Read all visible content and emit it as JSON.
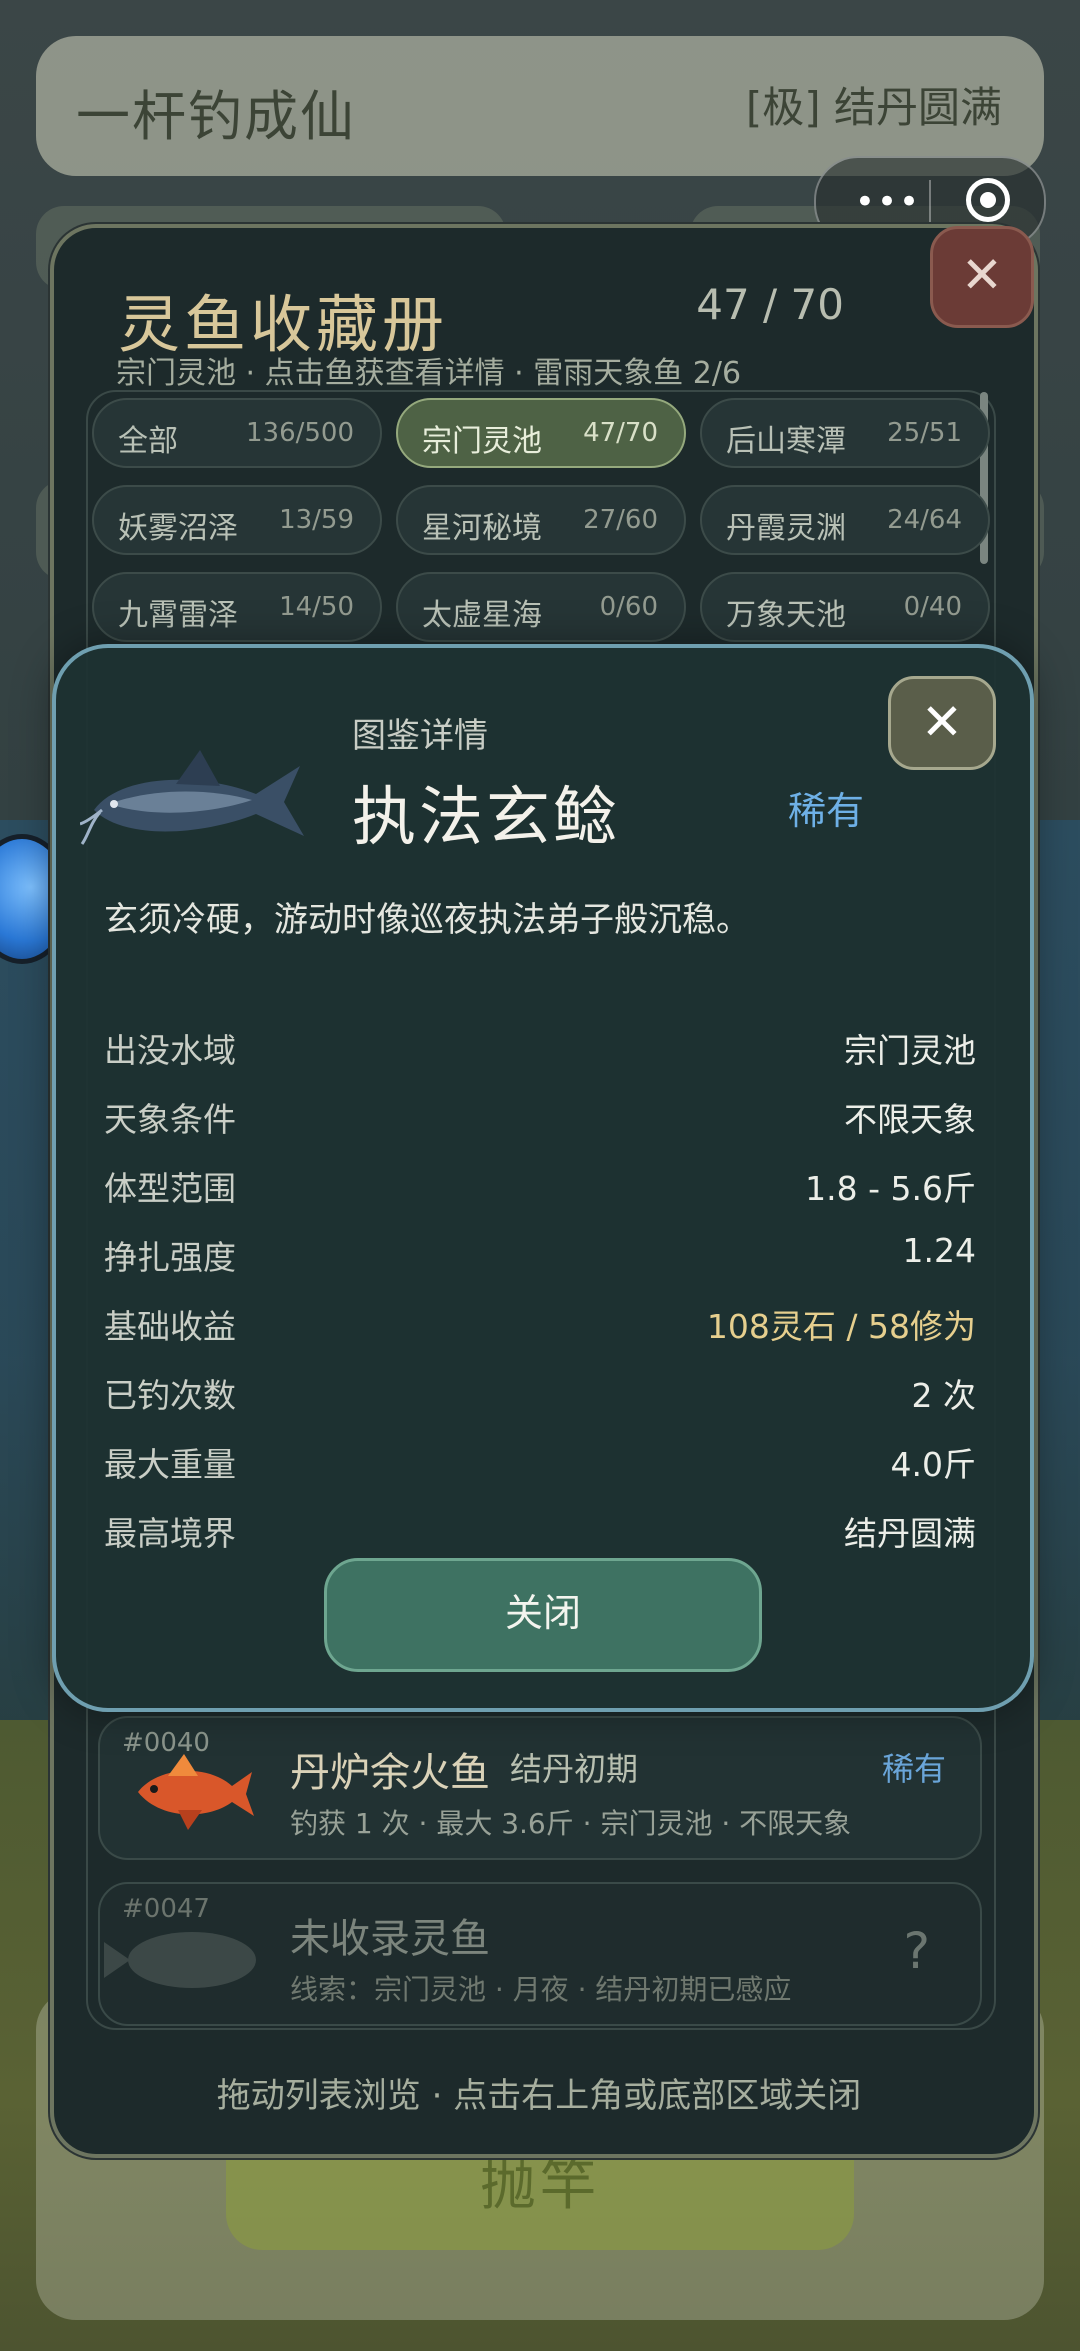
{
  "app": {
    "title": "一杆钓成仙",
    "realm": "[极] 结丹圆满",
    "cast_label": "抛竿"
  },
  "capsule": {
    "more_label": "•••"
  },
  "collection": {
    "title": "灵鱼收藏册",
    "count": "47 / 70",
    "subtitle": "宗门灵池 · 点击鱼获查看详情 · 雷雨天象鱼 2/6",
    "close_label": "✕",
    "filters": [
      {
        "name": "全部",
        "count": "136/500"
      },
      {
        "name": "宗门灵池",
        "count": "47/70"
      },
      {
        "name": "后山寒潭",
        "count": "25/51"
      },
      {
        "name": "妖雾沼泽",
        "count": "13/59"
      },
      {
        "name": "星河秘境",
        "count": "27/60"
      },
      {
        "name": "丹霞灵渊",
        "count": "24/64"
      },
      {
        "name": "九霄雷泽",
        "count": "14/50"
      },
      {
        "name": "太虚星海",
        "count": "0/60"
      },
      {
        "name": "万象天池",
        "count": "0/40"
      }
    ],
    "active_filter": "宗门灵池",
    "items": [
      {
        "no": "#0040",
        "name": "丹炉余火鱼",
        "realm": "结丹初期",
        "rarity": "稀有",
        "sub": "钓获 1 次 · 最大 3.6斤 · 宗门灵池 · 不限天象"
      },
      {
        "no": "#0047",
        "name": "未收录灵鱼",
        "realm": "",
        "rarity": "?",
        "sub": "线索：宗门灵池 · 月夜 · 结丹初期已感应"
      }
    ],
    "hint": "拖动列表浏览 · 点击右上角或底部区域关闭"
  },
  "detail": {
    "label": "图鉴详情",
    "name": "执法玄鲶",
    "rarity": "稀有",
    "close_label": "✕",
    "description": "玄须冷硬，游动时像巡夜执法弟子般沉稳。",
    "rows": [
      {
        "key": "出没水域",
        "value": "宗门灵池"
      },
      {
        "key": "天象条件",
        "value": "不限天象"
      },
      {
        "key": "体型范围",
        "value": "1.8 - 5.6斤"
      },
      {
        "key": "挣扎强度",
        "value": "1.24"
      },
      {
        "key": "基础收益",
        "value": "108灵石 / 58修为"
      },
      {
        "key": "已钓次数",
        "value": "2 次"
      },
      {
        "key": "最大重量",
        "value": "4.0斤"
      },
      {
        "key": "最高境界",
        "value": "结丹圆满"
      }
    ],
    "close_button": "关闭"
  },
  "colors": {
    "rarity_rare": "#6eb0e6",
    "income_gold": "#e6cf8e",
    "accent_green": "#3e7262"
  },
  "icons": {
    "close": "close-icon",
    "fish": "fish-icon",
    "more": "more-dots-icon",
    "target": "target-icon"
  }
}
